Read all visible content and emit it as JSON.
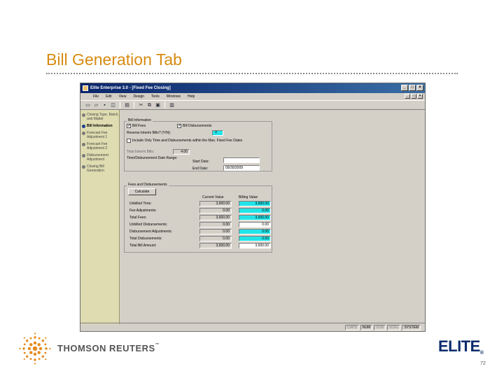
{
  "slide": {
    "title": "Bill Generation Tab",
    "page_number": "72",
    "brand_left": "THOMSON REUTERS",
    "brand_left_tm": "™",
    "brand_right": "ELITE",
    "brand_right_mark": "®"
  },
  "window": {
    "title": "Elite Enterprise 3.0 - [Fixed Fee Closing]",
    "controls": [
      "_",
      "□",
      "×"
    ],
    "menu": [
      "File",
      "Edit",
      "View",
      "Design",
      "Tools",
      "Windows",
      "Help"
    ],
    "toolbar_icons": [
      "new-icon",
      "open-icon",
      "save-icon",
      "preview-icon",
      "print-icon",
      "cut-icon",
      "copy-icon",
      "paste-icon",
      "chart-icon"
    ]
  },
  "nav": {
    "items": [
      {
        "label": "Closing Type, Batch, and Matter",
        "active": false
      },
      {
        "label": "Bill Information",
        "active": true
      },
      {
        "label": "Forecast Fee Adjustment 1",
        "active": false
      },
      {
        "label": "Forecast Fee Adjustment 2",
        "active": false
      },
      {
        "label": "Disbursement Adjustment",
        "active": false
      },
      {
        "label": "Closing Bill Generation",
        "active": false
      }
    ]
  },
  "bill_info": {
    "group_label": "Bill Information",
    "bill_fees_label": "Bill Fees",
    "bill_disb_label": "Bill Disbursements",
    "reverse_label": "Reverse Interim Bills? (Y/N):",
    "reverse_value": "Y",
    "include_label": "Include Only Time and Disbursements within the Max. Fixed Fee Dates",
    "total_interim_label": "Total Interim Bills:",
    "total_interim_value": "4.00",
    "date_range_label": "Time/Disbursement Date Range:",
    "start_date_label": "Start Date:",
    "start_date_value": "",
    "end_date_label": "End Date:",
    "end_date_value": "09/30/2009"
  },
  "fees_disb": {
    "group_label": "Fees and Disbursements",
    "calculate_label": "Calculate",
    "col_current": "Current Value",
    "col_billing": "Billing Value",
    "rows": [
      {
        "label": "Unbilled Time:",
        "current": "3,600.00",
        "billing": "3,600.00"
      },
      {
        "label": "Fee Adjustments:",
        "current": "0.00",
        "billing": "0.00"
      },
      {
        "label": "Total Fees:",
        "current": "3,600.00",
        "billing": "3,600.00"
      },
      {
        "label": "Unbilled Disbursements:",
        "current": "0.00",
        "billing": "0.00"
      },
      {
        "label": "Disbursement Adjustments:",
        "current": "0.00",
        "billing": "0.00"
      },
      {
        "label": "Total Disbursements:",
        "current": "0.00",
        "billing": "0.00"
      },
      {
        "label": "Total Bill Amount:",
        "current": "3,600.00",
        "billing": "3,600.00"
      }
    ]
  },
  "statusbar": [
    "CAPS",
    "NUM",
    "OVR",
    "SCRL",
    "SYSTEM"
  ],
  "colors": {
    "title": "#d88a12",
    "elite": "#0b2c6b",
    "nav_bg": "#dedcb0",
    "highlight_field": "#22e4e8"
  }
}
